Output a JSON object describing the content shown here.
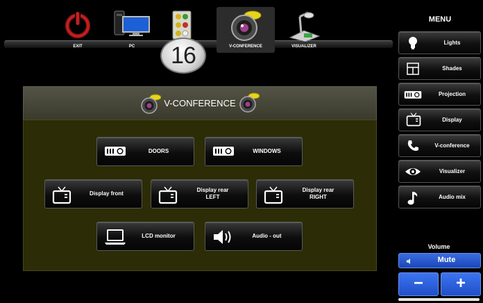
{
  "room_number": "16",
  "top_nav": [
    {
      "label": "EXIT",
      "icon": "power-icon"
    },
    {
      "label": "PC",
      "icon": "pc-icon"
    },
    {
      "label": "",
      "icon": "av-connector-icon"
    },
    {
      "label": "V-CONFERENCE",
      "icon": "webcam-icon",
      "active": true
    },
    {
      "label": "VISUALIZER",
      "icon": "visualizer-icon"
    }
  ],
  "panel": {
    "title": "V-CONFERENCE",
    "buttons": [
      {
        "label": "DOORS",
        "icon": "projector-icon"
      },
      {
        "label": "WINDOWS",
        "icon": "projector-icon"
      },
      {
        "label": "Display front",
        "icon": "tv-icon"
      },
      {
        "label": "Display rear\nLEFT",
        "icon": "tv-icon"
      },
      {
        "label": "Display rear\nRIGHT",
        "icon": "tv-icon"
      },
      {
        "label": "LCD monitor",
        "icon": "laptop-icon"
      },
      {
        "label": "Audio - out",
        "icon": "speaker-icon"
      }
    ]
  },
  "menu": {
    "title": "MENU",
    "items": [
      {
        "label": "Lights",
        "icon": "bulb-icon"
      },
      {
        "label": "Shades",
        "icon": "window-icon"
      },
      {
        "label": "Projection",
        "icon": "projector-icon"
      },
      {
        "label": "Display",
        "icon": "tv-icon"
      },
      {
        "label": "V-conference",
        "icon": "phone-icon"
      },
      {
        "label": "Visualizer",
        "icon": "eye-icon"
      },
      {
        "label": "Audio mix",
        "icon": "music-note-icon"
      }
    ]
  },
  "volume": {
    "title": "Volume",
    "mute_label": "Mute",
    "minus_label": "−",
    "plus_label": "+"
  },
  "colors": {
    "accent_blue": "#2a5be0",
    "panel_bg": "#2c2c06",
    "power_red": "#b31b1b"
  }
}
